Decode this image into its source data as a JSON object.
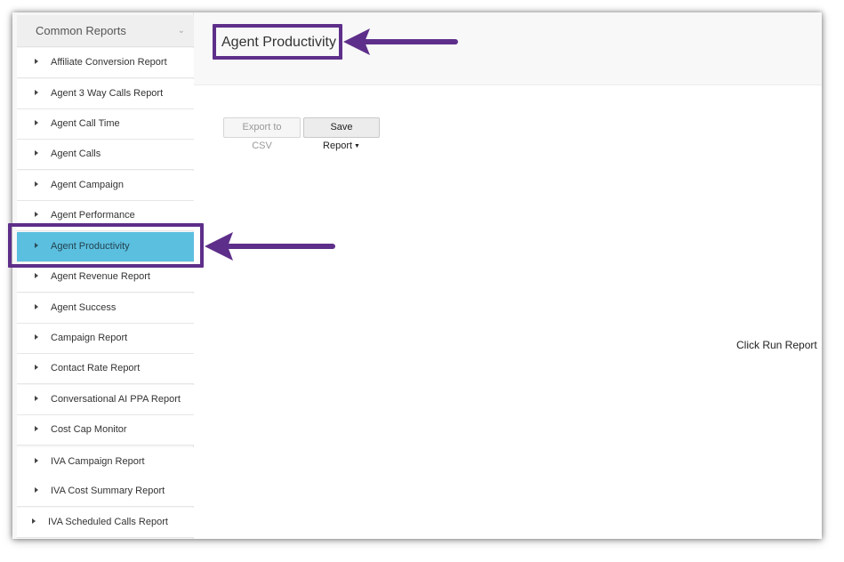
{
  "sidebar": {
    "header_title": "Common Reports",
    "header_chevron": "⌄",
    "items": [
      {
        "label": "Affiliate Conversion Report"
      },
      {
        "label": "Agent 3 Way Calls Report"
      },
      {
        "label": "Agent Call Time"
      },
      {
        "label": "Agent Calls"
      },
      {
        "label": "Agent Campaign"
      },
      {
        "label": "Agent Performance"
      },
      {
        "label": "Agent Productivity"
      },
      {
        "label": "Agent Revenue Report"
      },
      {
        "label": "Agent Success"
      },
      {
        "label": "Campaign Report"
      },
      {
        "label": "Contact Rate Report"
      },
      {
        "label": "Conversational AI PPA Report"
      },
      {
        "label": "Cost Cap Monitor"
      },
      {
        "label": "IVA Campaign Report"
      },
      {
        "label": "IVA Cost Summary Report"
      },
      {
        "label": "IVA Scheduled Calls Report"
      }
    ],
    "active_item": "Agent Productivity"
  },
  "main": {
    "title": "Agent Productivity",
    "export_label": "Export to CSV",
    "save_label": "Save Report",
    "save_dropdown_icon": "▼",
    "empty_message": "Click Run Report"
  },
  "colors": {
    "active_item_bg": "#5bbfdf",
    "annotation_purple": "#5e2f8a"
  }
}
